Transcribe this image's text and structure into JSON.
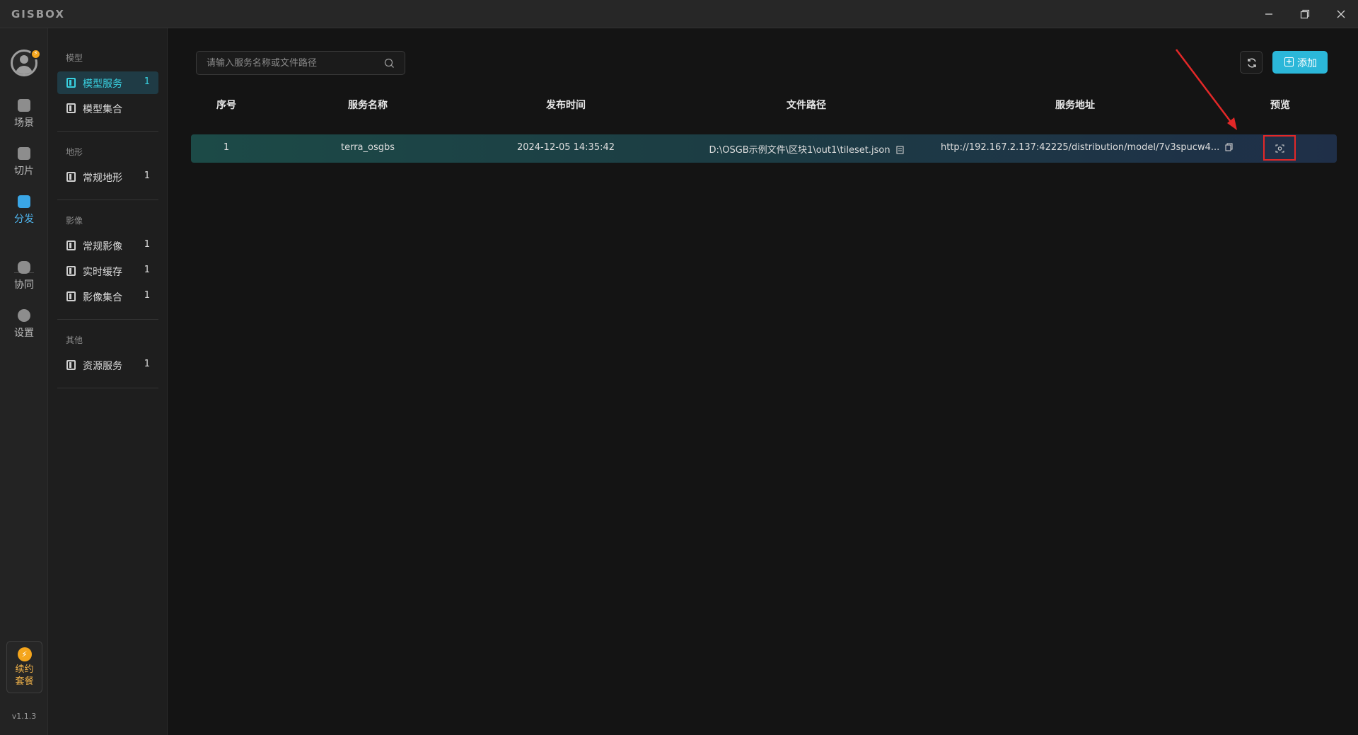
{
  "app": {
    "logo": "GISBOX"
  },
  "window": {
    "minimize": "—",
    "restore": "❐",
    "close": "✕"
  },
  "rail": {
    "badge": "⚡",
    "items": [
      {
        "label": "场景",
        "icon": "home-icon"
      },
      {
        "label": "切片",
        "icon": "slice-icon"
      },
      {
        "label": "分发",
        "icon": "distribute-icon"
      },
      {
        "label": "协同",
        "icon": "lock-icon"
      },
      {
        "label": "设置",
        "icon": "gear-icon"
      }
    ],
    "renew": {
      "line1": "续约",
      "line2": "套餐"
    },
    "version": "v1.1.3"
  },
  "sidebar": {
    "sections": [
      {
        "title": "模型",
        "items": [
          {
            "label": "模型服务",
            "count": "1"
          },
          {
            "label": "模型集合",
            "count": ""
          }
        ]
      },
      {
        "title": "地形",
        "items": [
          {
            "label": "常规地形",
            "count": "1"
          }
        ]
      },
      {
        "title": "影像",
        "items": [
          {
            "label": "常规影像",
            "count": "1"
          },
          {
            "label": "实时缓存",
            "count": "1"
          },
          {
            "label": "影像集合",
            "count": "1"
          }
        ]
      },
      {
        "title": "其他",
        "items": [
          {
            "label": "资源服务",
            "count": "1"
          }
        ]
      }
    ]
  },
  "toolbar": {
    "search_placeholder": "请输入服务名称或文件路径",
    "add_label": "添加"
  },
  "table": {
    "headers": [
      "序号",
      "服务名称",
      "发布时间",
      "文件路径",
      "服务地址",
      "预览"
    ],
    "rows": [
      {
        "index": "1",
        "name": "terra_osgbs",
        "time": "2024-12-05 14:35:42",
        "path": "D:\\OSGB示例文件\\区块1\\out1\\tileset.json",
        "url": "http://192.167.2.137:42225/distribution/model/7v3spucw4..."
      }
    ]
  },
  "colors": {
    "accent": "#39d0e0",
    "primary_button": "#2bb7d9",
    "highlight": "#e32828"
  }
}
